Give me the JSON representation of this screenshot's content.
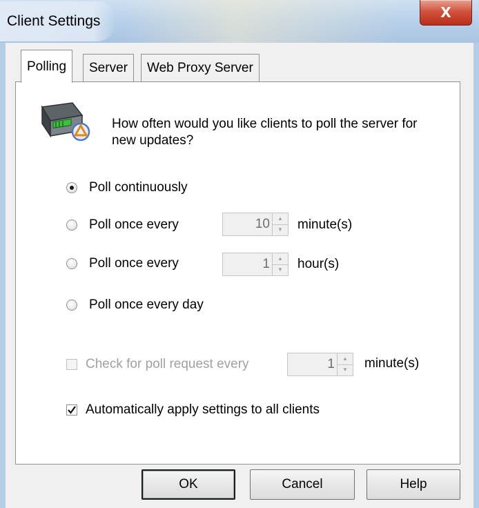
{
  "window": {
    "title": "Client Settings",
    "close_glyph": "X"
  },
  "tabs": [
    {
      "label": "Polling",
      "active": true
    },
    {
      "label": "Server",
      "active": false
    },
    {
      "label": "Web Proxy Server",
      "active": false
    }
  ],
  "polling": {
    "icon": "server-icon",
    "question": "How often would you like clients to poll the server for new updates?",
    "options": [
      {
        "label": "Poll continuously",
        "selected": true
      },
      {
        "label": "Poll once every",
        "selected": false,
        "value": "10",
        "unit": "minute(s)"
      },
      {
        "label": "Poll once every",
        "selected": false,
        "value": "1",
        "unit": "hour(s)"
      },
      {
        "label": "Poll once every day",
        "selected": false
      }
    ],
    "check_poll": {
      "label": "Check for poll request every",
      "checked": false,
      "enabled": false,
      "value": "1",
      "unit": "minute(s)"
    },
    "auto_apply": {
      "label": "Automatically apply settings to all clients",
      "checked": true
    }
  },
  "buttons": {
    "ok": "OK",
    "cancel": "Cancel",
    "help": "Help"
  },
  "colors": {
    "title_bar": "#b9d1ea",
    "close_button": "#c8402c",
    "panel": "#ffffff",
    "dialog": "#f0f0f0",
    "disabled_text": "#a0a0a0"
  }
}
